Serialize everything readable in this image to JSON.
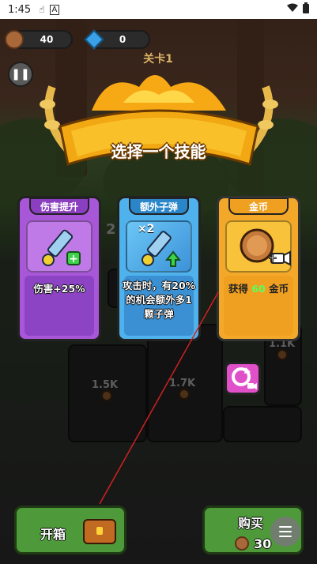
{
  "status_bar": {
    "time": "1:45",
    "icons": [
      "touch-icon",
      "a-icon",
      "wifi-icon",
      "battery-icon"
    ]
  },
  "hud": {
    "coins": "40",
    "gems": "0",
    "level": "关卡1",
    "pause_icon": "pause-icon"
  },
  "banner": {
    "title": "选择一个技能"
  },
  "board": {
    "hp_labels": [
      "1.5K",
      "1.7K",
      "1.1K"
    ],
    "partial_value": "2"
  },
  "cards": [
    {
      "tab": "伤害提升",
      "icon": "sword-plus-icon",
      "description": "伤害+25%",
      "color": "#a857d8"
    },
    {
      "tab": "额外子弹",
      "icon": "sword-double-icon",
      "badge": "×2",
      "description": "攻击时，有20%的机会额外多1颗子弹",
      "color": "#4fb2ec"
    },
    {
      "tab": "金币",
      "icon": "coin-ad-icon",
      "description_prefix": "获得",
      "description_amount": "60",
      "description_suffix": "金币",
      "color": "#f4a82a"
    }
  ],
  "refresh": {
    "icon": "refresh-ad-icon"
  },
  "bottom": {
    "open_box_label": "开箱",
    "buy_label": "购买",
    "buy_price": "30"
  },
  "menu_fab": {
    "icon": "menu-icon"
  }
}
